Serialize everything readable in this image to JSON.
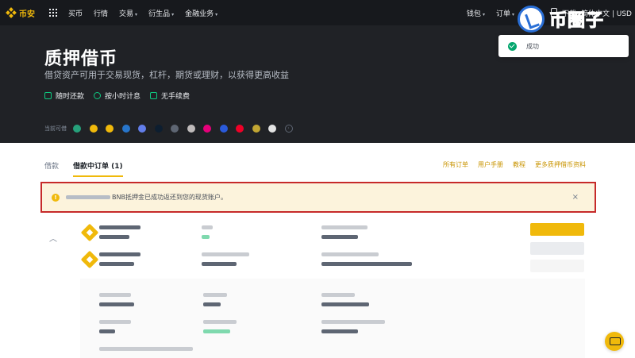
{
  "nav": {
    "brand": "币安",
    "items": [
      {
        "label": "买币",
        "has_caret": false
      },
      {
        "label": "行情",
        "has_caret": false
      },
      {
        "label": "交易",
        "has_caret": true
      },
      {
        "label": "衍生品",
        "has_caret": true
      },
      {
        "label": "金融业务",
        "has_caret": true
      }
    ],
    "right": [
      {
        "label": "钱包",
        "has_caret": true
      },
      {
        "label": "订单",
        "has_caret": true
      }
    ],
    "download_label": "下载",
    "tail_label": "简体中文 | USD"
  },
  "watermark": {
    "text": "币圈子",
    "color": "#2a6fd6"
  },
  "toast": {
    "text": "成功",
    "status": "success",
    "color": "#03a66d"
  },
  "hero": {
    "title": "质押借币",
    "subtitle": "借贷资产可用于交易现货，杠杆，期货或理财，以获得更高收益",
    "features": [
      {
        "label": "随时还款",
        "icon": "shield-check-icon"
      },
      {
        "label": "按小时计息",
        "icon": "clock-check-icon"
      },
      {
        "label": "无手续费",
        "icon": "no-fee-icon"
      }
    ],
    "coins_label": "当前可借",
    "coins": [
      {
        "icon": "usdt-icon",
        "color": "#26a17b"
      },
      {
        "icon": "bnb-icon",
        "color": "#f0b90b"
      },
      {
        "icon": "busd-icon",
        "color": "#f0b90b"
      },
      {
        "icon": "usdc-icon",
        "color": "#2775ca"
      },
      {
        "icon": "eth-icon",
        "color": "#627eea"
      },
      {
        "icon": "ada-icon",
        "color": "#0d1e30"
      },
      {
        "icon": "xrp-icon",
        "color": "#5e6673"
      },
      {
        "icon": "ltc-icon",
        "color": "#bfbbbb"
      },
      {
        "icon": "dot-icon",
        "color": "#e6007a"
      },
      {
        "icon": "link-icon",
        "color": "#2a5ada"
      },
      {
        "icon": "trx-icon",
        "color": "#ef0027"
      },
      {
        "icon": "doge-icon",
        "color": "#c2a633"
      },
      {
        "icon": "xlm-icon",
        "color": "#e3e3e3"
      }
    ]
  },
  "tabs": [
    {
      "label": "借款",
      "active": false
    },
    {
      "label": "借款中订单 (1)",
      "active": true
    }
  ],
  "links": [
    "所有订单",
    "用户手册",
    "教程",
    "更多质押借币资料"
  ],
  "notice": {
    "text": "BNB抵押金已成功返还到您的现货账户。",
    "close": "×",
    "accent": "#c62a2a"
  },
  "chat": {
    "icon": "chat-icon"
  }
}
